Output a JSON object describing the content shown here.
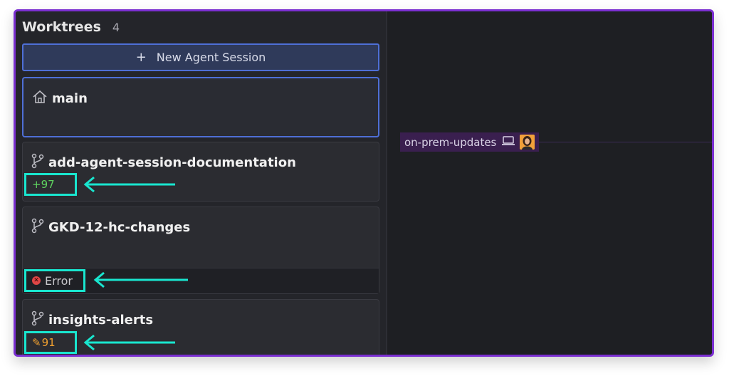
{
  "sidebar": {
    "title": "Worktrees",
    "count": "4",
    "new_session_label": "New Agent Session",
    "worktrees": [
      {
        "name": "main",
        "icon": "home-icon"
      },
      {
        "name": "add-agent-session-documentation",
        "icon": "git-branch-icon",
        "stat": "+97",
        "stat_color": "#5fd35f"
      },
      {
        "name": "GKD-12-hc-changes",
        "icon": "git-branch-icon",
        "status": "Error"
      },
      {
        "name": "insights-alerts",
        "icon": "git-branch-icon",
        "stat": "91",
        "stat_icon": "pencil-icon",
        "stat_color": "#f0a030"
      }
    ]
  },
  "main": {
    "branch_label": "on-prem-updates",
    "device_icon": "laptop-icon"
  },
  "colors": {
    "accent_border": "#7b2fd1",
    "highlight": "#19e6cf",
    "selected_border": "#4e6fd6"
  }
}
